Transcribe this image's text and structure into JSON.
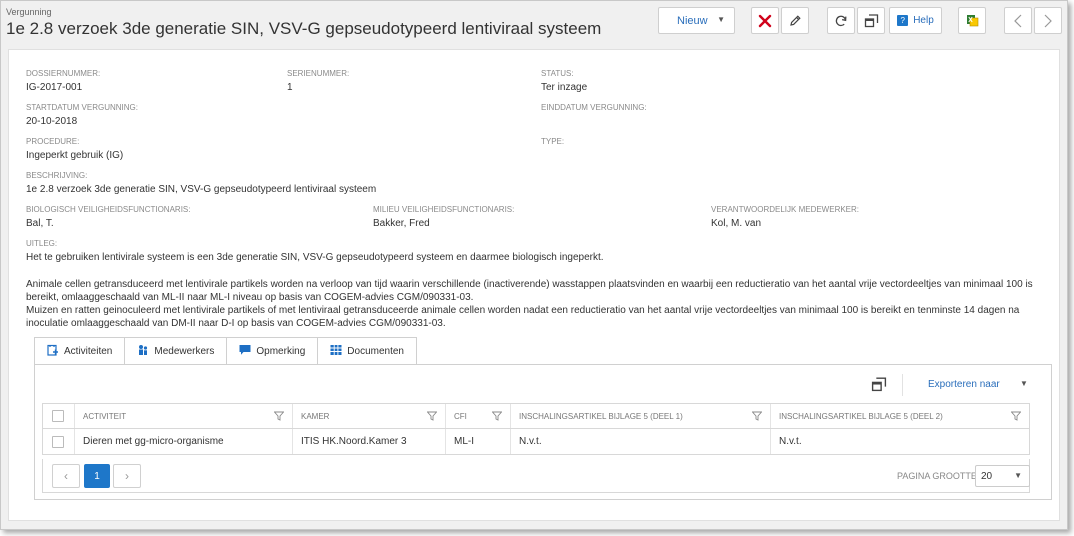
{
  "header": {
    "breadcrumb": "Vergunning",
    "title": "1e 2.8 verzoek 3de generatie SIN, VSV-G gepseudotypeerd lentiviraal systeem",
    "toolbar": {
      "new_label": "Nieuw",
      "help_label": "Help"
    }
  },
  "details": {
    "dossiernummer_label": "DOSSIERNUMMER:",
    "dossiernummer": "IG-2017-001",
    "serienummer_label": "SERIENUMMER:",
    "serienummer": "1",
    "status_label": "STATUS:",
    "status": "Ter inzage",
    "startdatum_label": "STARTDATUM VERGUNNING:",
    "startdatum": "20-10-2018",
    "einddatum_label": "EINDDATUM VERGUNNING:",
    "einddatum": "",
    "type_label": "TYPE:",
    "type": "",
    "procedure_label": "PROCEDURE:",
    "procedure": "Ingeperkt gebruik (IG)",
    "beschrijving_label": "BESCHRIJVING:",
    "beschrijving": "1e 2.8 verzoek 3de generatie SIN, VSV-G gepseudotypeerd lentiviraal systeem",
    "bvf_label": "BIOLOGISCH VEILIGHEIDSFUNCTIONARIS:",
    "bvf": "Bal, T.",
    "mvf_label": "MILIEU VEILIGHEIDSFUNCTIONARIS:",
    "mvf": "Bakker, Fred",
    "vm_label": "VERANTWOORDELIJK MEDEWERKER:",
    "vm": "Kol, M. van",
    "uitleg_label": "UITLEG:",
    "uitleg_p1": "Het te gebruiken lentivirale systeem is een 3de generatie SIN, VSV-G gepseudotypeerd systeem en daarmee biologisch ingeperkt.",
    "uitleg_p2": "Animale cellen getransduceerd met lentivirale partikels worden na verloop van tijd waarin verschillende (inactiverende) wasstappen plaatsvinden en waarbij een reductieratio van het aantal vrije vectordeeltjes van minimaal 100 is bereikt, omlaaggeschaald van ML-II naar ML-I niveau op basis van COGEM-advies CGM/090331-03.",
    "uitleg_p3": "Muizen en ratten geinoculeerd met lentivirale partikels of met lentiviraal getransduceerde animale cellen worden nadat een reductieratio van het aantal vrije vectordeeltjes van minimaal 100 is bereikt en tenminste 14 dagen na inoculatie omlaaggeschaald van DM-II naar D-I op basis van COGEM-advies CGM/090331-03."
  },
  "tabs": [
    {
      "label": "Activiteiten",
      "active": true
    },
    {
      "label": "Medewerkers",
      "active": false
    },
    {
      "label": "Opmerking",
      "active": false
    },
    {
      "label": "Documenten",
      "active": false
    }
  ],
  "panel": {
    "export_label": "Exporteren naar"
  },
  "grid": {
    "columns": [
      "ACTIVITEIT",
      "KAMER",
      "CFI",
      "INSCHALINGSARTIKEL BIJLAGE 5 (DEEL 1)",
      "INSCHALINGSARTIKEL BIJLAGE 5 (DEEL 2)"
    ],
    "rows": [
      [
        "Dieren met gg-micro-organisme",
        "ITIS HK.Noord.Kamer 3",
        "ML-I",
        "N.v.t.",
        "N.v.t."
      ]
    ]
  },
  "pager": {
    "current_page": "1",
    "page_size_label": "PAGINA GROOTTE",
    "page_size": "20"
  },
  "colors": {
    "accent": "#1e77c9",
    "link": "#2a6ebb",
    "close_red": "#d0021b"
  }
}
